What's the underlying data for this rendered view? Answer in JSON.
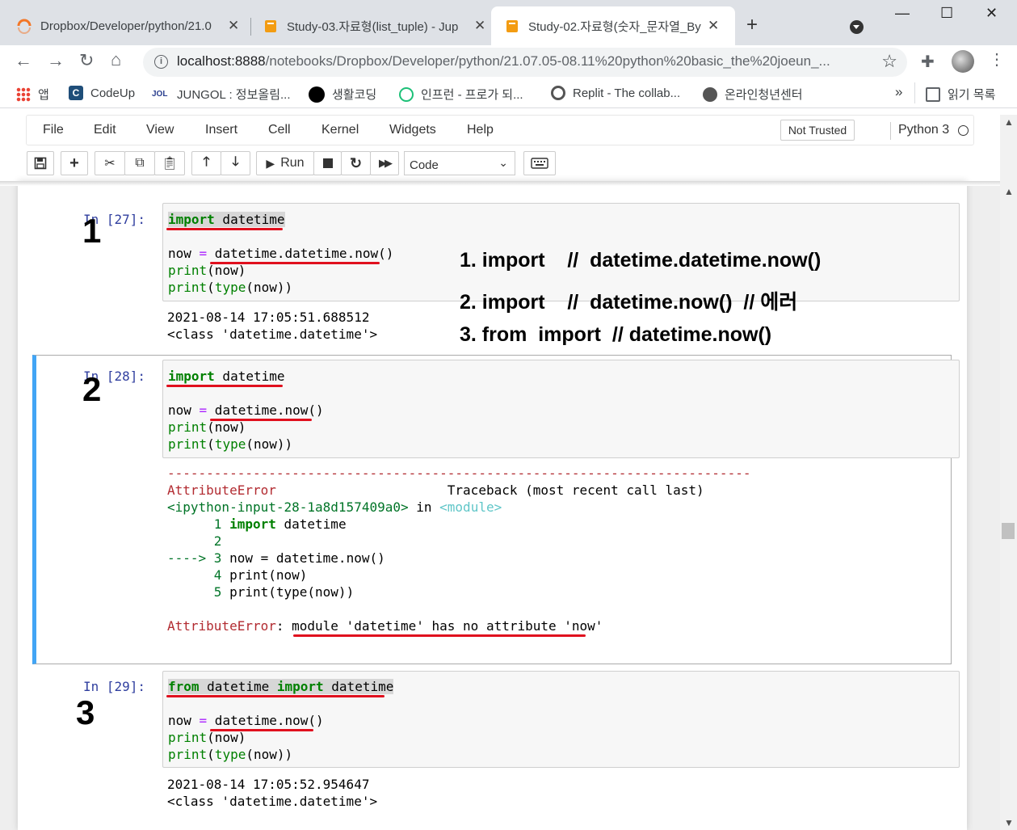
{
  "browser": {
    "tabs": [
      {
        "title": "Dropbox/Developer/python/21.0",
        "close": "✕"
      },
      {
        "title": "Study-03.자료형(list_tuple) - Jup",
        "close": "✕"
      },
      {
        "title": "Study-02.자료형(숫자_문자열_By",
        "close": "✕"
      }
    ],
    "new_tab": "+",
    "window_controls": {
      "minimize": "—",
      "maximize": "☐",
      "close": "✕"
    },
    "url_host": "localhost:8888",
    "url_path": "/notebooks/Dropbox/Developer/python/21.07.05-08.11%20python%20basic_the%20joeun_...",
    "bookmarks": [
      {
        "label": "앱",
        "icon": "apps-grid-icon"
      },
      {
        "label": "CodeUp",
        "icon": "codeup-icon"
      },
      {
        "label": "JUNGOL : 정보올림...",
        "icon": "jungol-icon"
      },
      {
        "label": "생활코딩",
        "icon": "black-circle-icon"
      },
      {
        "label": "인프런 - 프로가 되...",
        "icon": "inflearn-icon"
      },
      {
        "label": "Replit - The collab...",
        "icon": "replit-icon"
      },
      {
        "label": "온라인청년센터",
        "icon": "globe-icon"
      }
    ],
    "bookmarks_more": "»",
    "reading_list": "읽기 목록"
  },
  "jupyter": {
    "menus": [
      "File",
      "Edit",
      "View",
      "Insert",
      "Cell",
      "Kernel",
      "Widgets",
      "Help"
    ],
    "trust": "Not Trusted",
    "kernel": "Python 3",
    "run_label": "Run",
    "cell_type": "Code"
  },
  "cells": [
    {
      "prompt": "In [27]:",
      "number": "1",
      "output": [
        "2021-08-14 17:05:51.688512",
        "<class 'datetime.datetime'>"
      ]
    },
    {
      "prompt": "In [28]:",
      "number": "2",
      "error_rule": "---------------------------------------------------------------------------",
      "error_name": "AttributeError",
      "traceback_header": "Traceback (most recent call last)",
      "input_ref": "<ipython-input-28-1a8d157409a0>",
      "in_word": " in ",
      "module_ref": "<module>",
      "final_error_name": "AttributeError",
      "final_error_msg": "module 'datetime' has no attribute 'now'"
    },
    {
      "prompt": "In [29]:",
      "number": "3",
      "output": [
        "2021-08-14 17:05:52.954647",
        "<class 'datetime.datetime'>"
      ]
    }
  ],
  "annotations": [
    "1. import    //  datetime.datetime.now()",
    "2. import    //  datetime.now()  // 에러",
    "3. from  import  // datetime.now()"
  ],
  "colors": {
    "underline": "#e0101e",
    "selected_border": "#42a5f5",
    "prompt": "#303f9f"
  }
}
